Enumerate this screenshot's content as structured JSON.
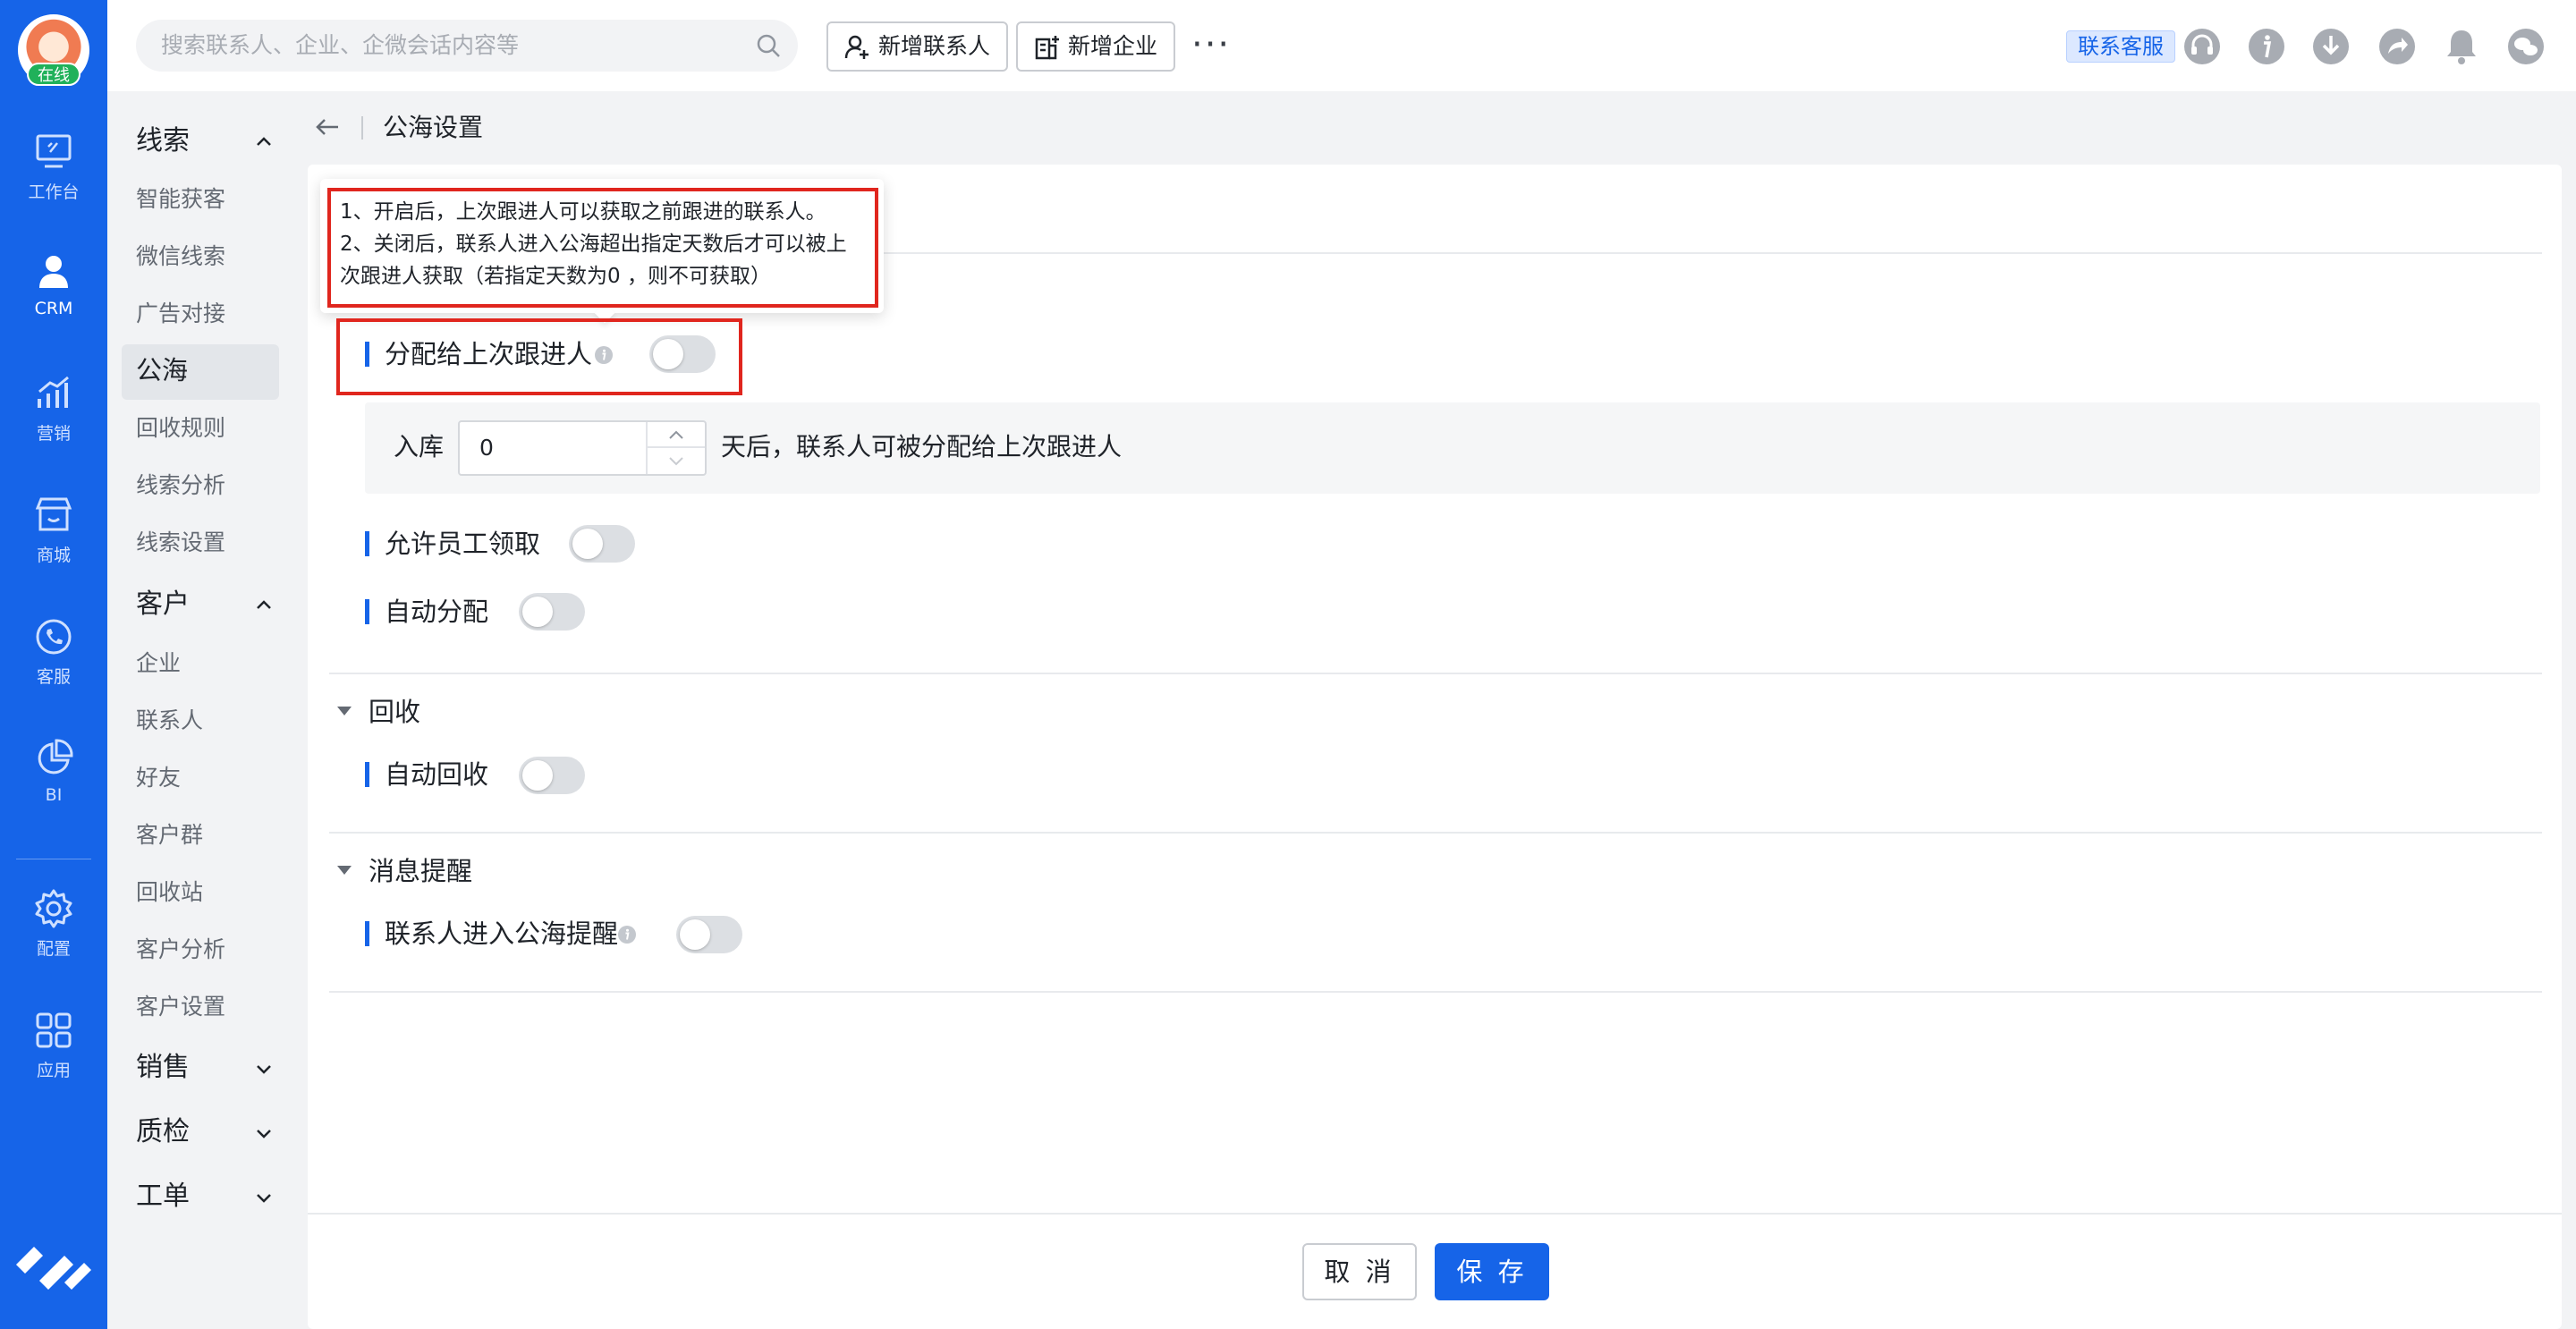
{
  "rail": {
    "online_badge": "在线",
    "items": [
      {
        "label": "工作台",
        "icon": "monitor-icon"
      },
      {
        "label": "CRM",
        "icon": "user-icon"
      },
      {
        "label": "营销",
        "icon": "growth-chart-icon"
      },
      {
        "label": "商城",
        "icon": "store-icon"
      },
      {
        "label": "客服",
        "icon": "phone-icon"
      },
      {
        "label": "BI",
        "icon": "pie-chart-icon"
      },
      {
        "label": "配置",
        "icon": "gear-icon"
      },
      {
        "label": "应用",
        "icon": "apps-grid-icon"
      }
    ],
    "active": "CRM"
  },
  "topbar": {
    "search_placeholder": "搜索联系人、企业、企微会话内容等",
    "add_contact": "新增联系人",
    "add_company": "新增企业",
    "more": "···",
    "service": "联系客服"
  },
  "subnav": {
    "groups": [
      {
        "label": "线索",
        "expanded": true
      },
      {
        "label": "客户",
        "expanded": true
      },
      {
        "label": "销售",
        "expanded": false
      },
      {
        "label": "质检",
        "expanded": false
      },
      {
        "label": "工单",
        "expanded": false
      }
    ],
    "lead_items": [
      "智能获客",
      "微信线索",
      "广告对接",
      "公海",
      "回收规则",
      "线索分析",
      "线索设置"
    ],
    "customer_items": [
      "企业",
      "联系人",
      "好友",
      "客户群",
      "回收站",
      "客户分析",
      "客户设置"
    ],
    "active_item": "公海"
  },
  "page": {
    "title": "公海设置"
  },
  "tooltip": {
    "line1": "1、开启后，上次跟进人可以获取之前跟进的联系人。",
    "line2": "2、关闭后，联系人进入公海超出指定天数后才可以被上",
    "line3": "次跟进人获取（若指定天数为0 ，则不可获取）"
  },
  "settings": {
    "assign_last": {
      "label": "分配给上次跟进人",
      "enabled": false
    },
    "storage": {
      "prefix": "入库",
      "value": "0",
      "suffix": "天后，联系人可被分配给上次跟进人"
    },
    "allow_claim": {
      "label": "允许员工领取",
      "enabled": false
    },
    "auto_assign": {
      "label": "自动分配",
      "enabled": false
    },
    "recycle_section": "回收",
    "auto_recycle": {
      "label": "自动回收",
      "enabled": false
    },
    "notify_section": "消息提醒",
    "pool_notify": {
      "label": "联系人进入公海提醒",
      "enabled": false
    }
  },
  "footer": {
    "cancel": "取 消",
    "save": "保 存"
  },
  "colors": {
    "brand": "#1664e8",
    "annotation": "#e0261e",
    "toggle_off": "#dcdfe3"
  }
}
